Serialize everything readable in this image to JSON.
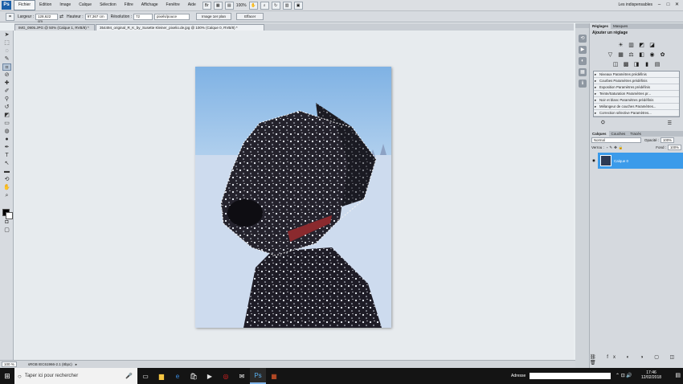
{
  "menubar": {
    "logo": "Ps",
    "items": [
      "Fichier",
      "Edition",
      "Image",
      "Calque",
      "Sélection",
      "Filtre",
      "Affichage",
      "Fenêtre",
      "Aide"
    ],
    "zoom": "100%",
    "workspace": "Les indispensables",
    "icons": [
      "bridge-icon",
      "mini-bridge-icon",
      "zoom-icon",
      "hand-icon",
      "rotate-view-icon",
      "arrange-icon",
      "screen-mode-icon"
    ]
  },
  "options": {
    "width_label": "Largeur :",
    "width_value": "128,622 cm",
    "height_label": "Hauteur :",
    "height_value": "97,367 cm",
    "resolution_label": "Résolution :",
    "resolution_value": "72",
    "resolution_unit": "pixels/pouce",
    "front_image_button": "Image 1er plan",
    "clear_button": "Effacer"
  },
  "tabs": [
    "IMG_0905.JPG @ 50% (Calque 1, RVB/8) *",
    "354494_original_R_K_by_Susette Kleiner_pixelio.de.jpg @ 100% (Calque 0, RVB/8) *"
  ],
  "status": {
    "zoom": "100 %",
    "profile": "sRGB IEC61966-2.1 (8bpc)"
  },
  "adjustments": {
    "tabs": [
      "Réglages",
      "Masques"
    ],
    "title": "Ajouter un réglage",
    "presets": [
      "Niveaux Paramètres prédéfinis",
      "Courbes Paramètres prédéfinis",
      "Exposition Paramètres prédéfinis",
      "Teinte/Saturation Paramètres pr...",
      "Noir et blanc Paramètres prédéfinis",
      "Mélangeur de couches Paramètres...",
      "Correction sélective Paramètres..."
    ]
  },
  "layers": {
    "tabs": [
      "Calques",
      "Couches",
      "Tracés"
    ],
    "blend_mode": "Normal",
    "opacity_label": "Opacité :",
    "opacity_value": "100%",
    "lock_label": "Verrou :",
    "fill_label": "Fond :",
    "fill_value": "100%",
    "layer_name": "Calque 0"
  },
  "taskbar": {
    "search_placeholder": "Taper ici pour rechercher",
    "address_label": "Adresse",
    "time": "17:46",
    "date": "12/02/2018",
    "apps": [
      "task-view-icon",
      "file-explorer-icon",
      "edge-icon",
      "store-icon",
      "media-icon",
      "opera-icon",
      "mail-icon",
      "photoshop-icon",
      "office-icon"
    ]
  }
}
